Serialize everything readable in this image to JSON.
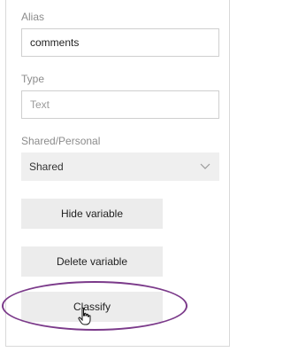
{
  "form": {
    "alias": {
      "label": "Alias",
      "value": "comments"
    },
    "type": {
      "label": "Type",
      "placeholder": "Text"
    },
    "shared_personal": {
      "label": "Shared/Personal",
      "selected": "Shared"
    }
  },
  "buttons": {
    "hide": "Hide variable",
    "delete": "Delete variable",
    "classify": "Classify"
  },
  "highlight": {
    "color": "#7b3a8a"
  },
  "icons": {
    "select_chevron": "chevron-down-icon",
    "cursor": "hand-pointer-icon"
  }
}
